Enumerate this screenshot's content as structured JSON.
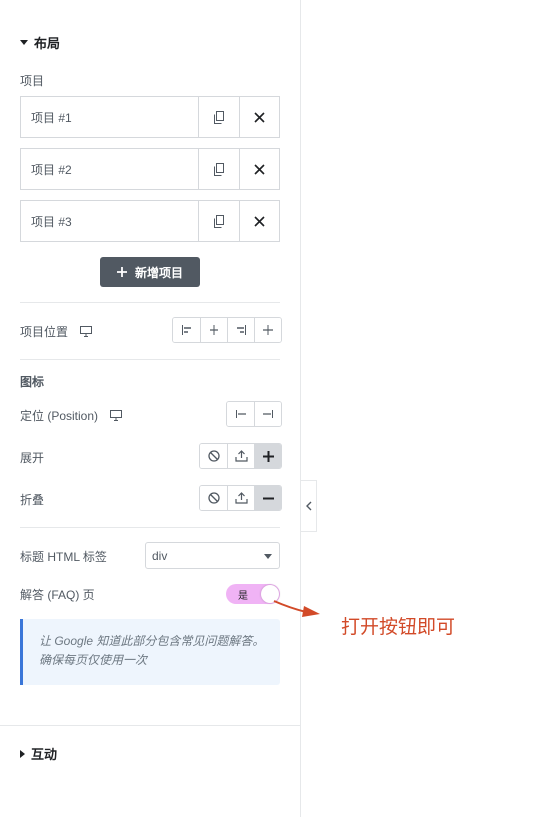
{
  "layout_section": {
    "title": "布局"
  },
  "items": {
    "label": "项目",
    "list": [
      {
        "title": "项目 #1"
      },
      {
        "title": "项目 #2"
      },
      {
        "title": "项目 #3"
      }
    ],
    "add_label": "新增项目"
  },
  "item_position": {
    "label": "项目位置"
  },
  "icon_section": {
    "heading": "图标",
    "position_label": "定位 (Position)",
    "expand_label": "展开",
    "collapse_label": "折叠"
  },
  "title_tag": {
    "label": "标题 HTML 标签",
    "value": "div"
  },
  "faq": {
    "label": "解答 (FAQ) 页",
    "toggle_text": "是",
    "enabled": true
  },
  "note": {
    "line1": "让 Google 知道此部分包含常见问题解答。",
    "line2": "确保每页仅使用一次"
  },
  "interaction_section": {
    "title": "互动"
  },
  "annotation": {
    "text": "打开按钮即可"
  },
  "colors": {
    "accent_toggle": "#f0b3f5",
    "annotation": "#d24a28",
    "note_border": "#3a76d8",
    "add_button": "#515962"
  },
  "icons": [
    "copy-icon",
    "close-icon",
    "desktop-icon",
    "plus-icon",
    "ban-icon",
    "upload-icon",
    "minus-icon",
    "chevron-left-icon"
  ]
}
